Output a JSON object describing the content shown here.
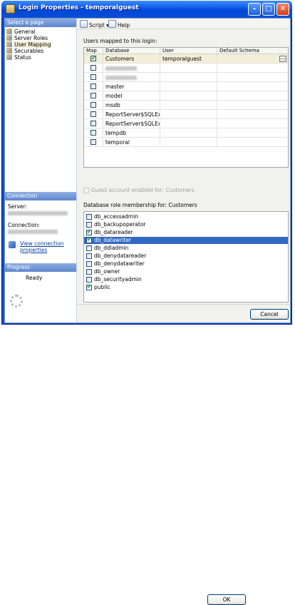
{
  "window": {
    "title": "Login Properties - temporalguest"
  },
  "left": {
    "select_page_header": "Select a page",
    "pages": [
      "General",
      "Server Roles",
      "User Mapping",
      "Securables",
      "Status"
    ],
    "selected_page": "User Mapping",
    "connection_header": "Connection",
    "server_label": "Server:",
    "connection_label": "Connection:",
    "view_link": [
      "View connection",
      "properties"
    ],
    "progress_header": "Progress",
    "progress_status": "Ready"
  },
  "toolbar": {
    "script_label": "Script",
    "help_label": "Help"
  },
  "mapping": {
    "title": "Users mapped to this login:",
    "columns": [
      "Map",
      "Database",
      "User",
      "Default Schema"
    ],
    "rows": [
      {
        "map": true,
        "database": "Customers",
        "user": "temporalguest",
        "schema": "",
        "selected": true,
        "redacted": false
      },
      {
        "map": false,
        "database": "",
        "user": "",
        "schema": "",
        "selected": false,
        "redacted": true
      },
      {
        "map": false,
        "database": "",
        "user": "",
        "schema": "",
        "selected": false,
        "redacted": true
      },
      {
        "map": false,
        "database": "master",
        "user": "",
        "schema": "",
        "selected": false,
        "redacted": false
      },
      {
        "map": false,
        "database": "model",
        "user": "",
        "schema": "",
        "selected": false,
        "redacted": false
      },
      {
        "map": false,
        "database": "msdb",
        "user": "",
        "schema": "",
        "selected": false,
        "redacted": false
      },
      {
        "map": false,
        "database": "ReportServer$SQLExpr...",
        "user": "",
        "schema": "",
        "selected": false,
        "redacted": false
      },
      {
        "map": false,
        "database": "ReportServer$SQLExpr...",
        "user": "",
        "schema": "",
        "selected": false,
        "redacted": false
      },
      {
        "map": false,
        "database": "tempdb",
        "user": "",
        "schema": "",
        "selected": false,
        "redacted": false
      },
      {
        "map": false,
        "database": "temporal",
        "user": "",
        "schema": "",
        "selected": false,
        "redacted": false
      }
    ],
    "ellipsis_label": "..."
  },
  "guest_label": "Guest account enabled for: Customers",
  "roles": {
    "title": "Database role membership for: Customers",
    "items": [
      {
        "name": "db_accessadmin",
        "checked": false,
        "selected": false
      },
      {
        "name": "db_backupoperator",
        "checked": false,
        "selected": false
      },
      {
        "name": "db_datareader",
        "checked": true,
        "selected": false
      },
      {
        "name": "db_datawriter",
        "checked": true,
        "selected": true
      },
      {
        "name": "db_ddladmin",
        "checked": false,
        "selected": false
      },
      {
        "name": "db_denydatareader",
        "checked": false,
        "selected": false
      },
      {
        "name": "db_denydatawriter",
        "checked": false,
        "selected": false
      },
      {
        "name": "db_owner",
        "checked": false,
        "selected": false
      },
      {
        "name": "db_securityadmin",
        "checked": false,
        "selected": false
      },
      {
        "name": "public",
        "checked": true,
        "selected": false
      }
    ]
  },
  "buttons": {
    "ok": "OK",
    "cancel": "Cancel"
  }
}
